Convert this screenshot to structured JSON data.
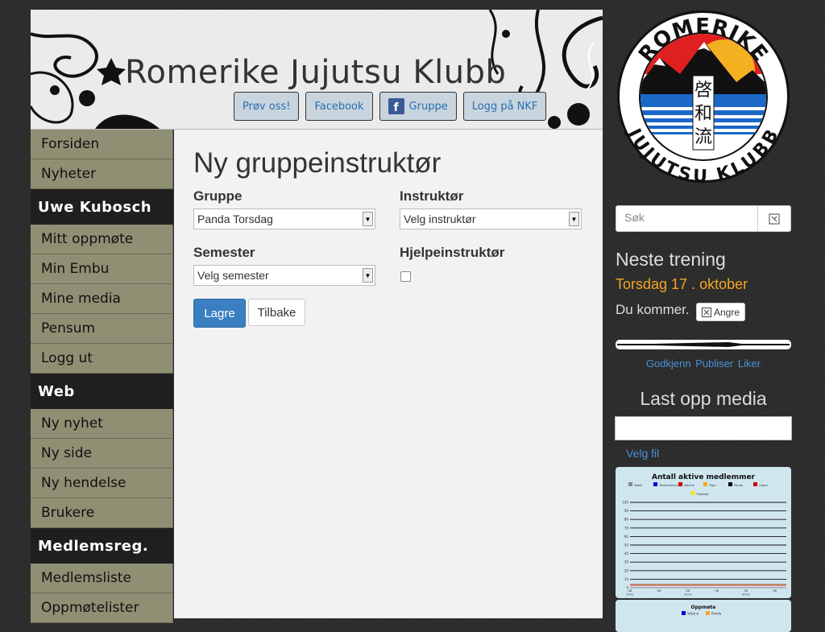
{
  "header": {
    "title": "Romerike Jujutsu Klubb",
    "buttons": [
      {
        "label": "Prøv oss!"
      },
      {
        "label": "Facebook"
      },
      {
        "label": "Gruppe"
      },
      {
        "label": "Logg på NKF"
      }
    ]
  },
  "sidebar": {
    "top": [
      "Forsiden",
      "Nyheter"
    ],
    "section_user": "Uwe Kubosch",
    "user_items": [
      "Mitt oppmøte",
      "Min Embu",
      "Mine media",
      "Pensum",
      "Logg ut"
    ],
    "section_web": "Web",
    "web_items": [
      "Ny nyhet",
      "Ny side",
      "Ny hendelse",
      "Brukere"
    ],
    "section_members": "Medlemsreg.",
    "member_items": [
      "Medlemsliste",
      "Oppmøtelister"
    ]
  },
  "form": {
    "title": "Ny gruppeinstruktør",
    "group_label": "Gruppe",
    "group_value": "Panda Torsdag",
    "instructor_label": "Instruktør",
    "instructor_value": "Velg instruktør",
    "semester_label": "Semester",
    "semester_value": "Velg semester",
    "assistant_label": "Hjelpeinstruktør",
    "save": "Lagre",
    "back": "Tilbake"
  },
  "right": {
    "logo_top": "ROMERIKE",
    "logo_bottom": "JUJUTSU KLUBB",
    "logo_kanji": [
      "啓",
      "和",
      "流"
    ],
    "search_placeholder": "Søk",
    "next_training_title": "Neste trening",
    "next_training_date": "Torsdag 17 . oktober",
    "attending": "Du kommer.",
    "cancel": "Angre",
    "media_links": [
      "Godkjenn",
      "Publiser",
      "Liker"
    ],
    "upload_title": "Last opp media",
    "choose_file": "Velg fil"
  },
  "chart_data": [
    {
      "type": "line",
      "title": "Antall aktive medlemmer",
      "series": [
        {
          "name": "Totalt",
          "color": "#888888"
        },
        {
          "name": "Tordenskrivende",
          "color": "#0000cc"
        },
        {
          "name": "Voksne",
          "color": "#cc0000"
        },
        {
          "name": "Tiger",
          "color": "#f5a623"
        },
        {
          "name": "Panda",
          "color": "#000000"
        },
        {
          "name": "Grønn",
          "color": "#cc0000"
        },
        {
          "name": "Prøvetid",
          "color": "#f5e623"
        }
      ],
      "y_ticks": [
        "100",
        "90",
        "80",
        "70",
        "60",
        "50",
        "40",
        "30",
        "20",
        "10",
        "0"
      ],
      "x_ticks": [
        "06\n2011",
        "06",
        "06\n2012",
        "06",
        "06\n2013",
        "06"
      ],
      "ylim": [
        0,
        100
      ]
    },
    {
      "type": "line",
      "title": "Oppmøte",
      "series": [
        {
          "name": "Voksne",
          "color": "#0000cc"
        },
        {
          "name": "Panda",
          "color": "#f5a623"
        }
      ]
    }
  ]
}
